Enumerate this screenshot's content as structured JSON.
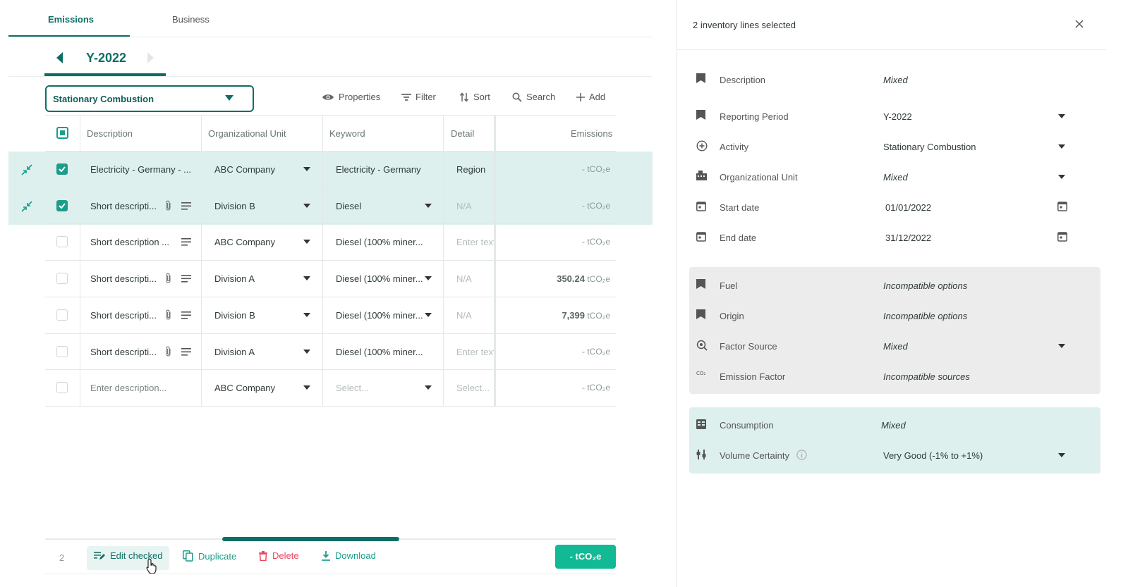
{
  "tabs": [
    {
      "label": "Emissions",
      "active": true
    },
    {
      "label": "Business",
      "active": false
    }
  ],
  "period": {
    "label": "Y-2022"
  },
  "activity_select": {
    "label": "Stationary Combustion"
  },
  "toolbar": {
    "properties": "Properties",
    "filter": "Filter",
    "sort": "Sort",
    "search": "Search",
    "add": "Add"
  },
  "table": {
    "headers": [
      "Description",
      "Organizational Unit",
      "Keyword",
      "Detail",
      "Emissions"
    ],
    "unit": "tCO₂e",
    "rows": [
      {
        "description": "Electricity - Germany - ...",
        "org_unit": "ABC Company",
        "keyword": "Electricity - Germany",
        "detail": "Region",
        "emissions": "-",
        "selected": true
      },
      {
        "description": "Short descripti...",
        "org_unit": "Division B",
        "keyword": "Diesel",
        "detail": "N/A",
        "emissions": "-",
        "selected": true
      },
      {
        "description": "Short description ...",
        "org_unit": "ABC Company",
        "keyword": "Diesel (100% miner...",
        "detail": "Enter text",
        "emissions": "-",
        "selected": false
      },
      {
        "description": "Short descripti...",
        "org_unit": "Division A",
        "keyword": "Diesel (100% miner...",
        "detail": "N/A",
        "emissions": "350.24",
        "selected": false
      },
      {
        "description": "Short descripti...",
        "org_unit": "Division B",
        "keyword": "Diesel (100% miner...",
        "detail": "N/A",
        "emissions": "7,399",
        "selected": false
      },
      {
        "description": "Short descripti...",
        "org_unit": "Division A",
        "keyword": "Diesel (100% miner...",
        "detail": "Enter text",
        "emissions": "-",
        "selected": false
      },
      {
        "description": "Enter description...",
        "org_unit": "ABC Company",
        "keyword": "Select...",
        "detail": "Select...",
        "emissions": "-",
        "selected": false
      }
    ]
  },
  "bottom_bar": {
    "count": "2",
    "edit_checked": "Edit checked",
    "duplicate": "Duplicate",
    "delete": "Delete",
    "download": "Download",
    "total": "- tCO₂e",
    "scroll_position": 0.45
  },
  "panel": {
    "title": "2 inventory lines selected",
    "fields": [
      {
        "label": "Description",
        "value": "Mixed"
      },
      {
        "label": "Reporting Period",
        "value": "Y-2022"
      },
      {
        "label": "Activity",
        "value": "Stationary Combustion"
      },
      {
        "label": "Organizational Unit",
        "value": "Mixed"
      },
      {
        "label": "Start date",
        "value": "01/01/2022"
      },
      {
        "label": "End date",
        "value": "31/12/2022"
      }
    ],
    "emission_fields": [
      {
        "label": "Fuel",
        "value": "Incompatible options"
      },
      {
        "label": "Origin",
        "value": "Incompatible options"
      },
      {
        "label": "Factor Source",
        "value": "Mixed"
      },
      {
        "label": "Emission Factor",
        "value": "Incompatible sources"
      }
    ],
    "consumption_fields": [
      {
        "label": "Consumption",
        "value": "Mixed"
      },
      {
        "label": "Volume Certainty",
        "value": "Very Good (-1% to +1%)"
      }
    ]
  },
  "colors": {
    "brand": "#0f6e64",
    "accent": "#1c9c8a",
    "selected_row": "#ddf0ee",
    "danger": "#e8485e",
    "total_button": "#11b994"
  }
}
